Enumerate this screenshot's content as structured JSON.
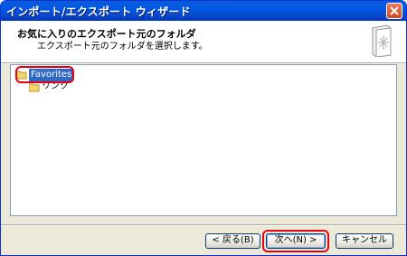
{
  "window": {
    "title": "インポート/エクスポート ウィザード"
  },
  "header": {
    "title": "お気に入りのエクスポート元のフォルダ",
    "subtitle": "エクスポート元のフォルダを選択します。"
  },
  "tree": {
    "items": [
      {
        "label": "Favorites",
        "selected": true
      },
      {
        "label": "リンク",
        "selected": false
      }
    ]
  },
  "buttons": {
    "back": "< 戻る(B)",
    "next": "次へ(N) >",
    "cancel": "キャンセル"
  },
  "colors": {
    "titlebar": "#0a5bd8",
    "selection": "#316ac5",
    "highlight_ring": "#e60012"
  }
}
